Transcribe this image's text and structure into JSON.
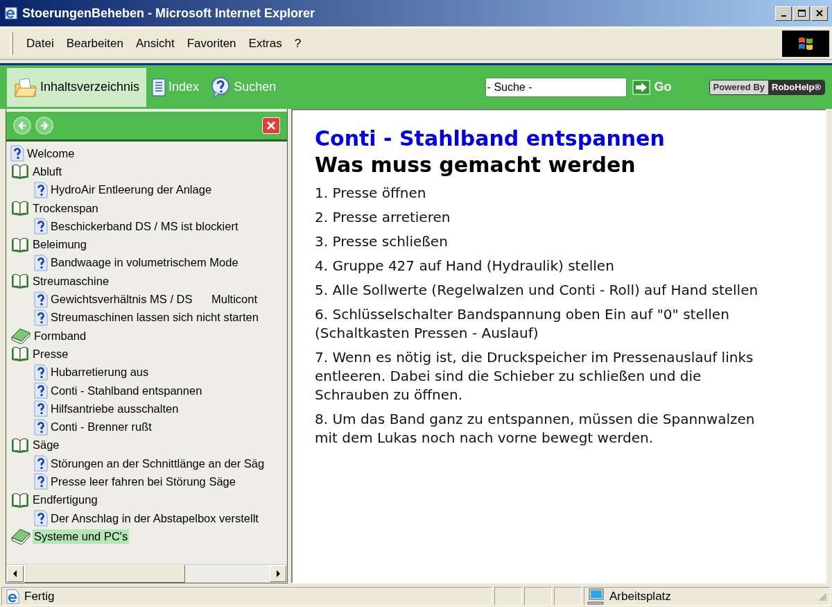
{
  "window": {
    "title": "StoerungenBeheben - Microsoft Internet Explorer"
  },
  "menu": [
    "Datei",
    "Bearbeiten",
    "Ansicht",
    "Favoriten",
    "Extras",
    "?"
  ],
  "help_toolbar": {
    "tabs": [
      {
        "label": "Inhaltsverzeichnis",
        "kind": "contents",
        "selected": true
      },
      {
        "label": "Index",
        "kind": "index",
        "selected": false
      },
      {
        "label": "Suchen",
        "kind": "search",
        "selected": false
      }
    ],
    "search": {
      "value": "- Suche -"
    },
    "go_label": "Go",
    "badge": {
      "prefix": "Powered By",
      "name": "RoboHelp®"
    }
  },
  "toc": [
    {
      "label": "Welcome",
      "kind": "topic",
      "selected": false
    },
    {
      "label": "Abluft",
      "kind": "book",
      "expanded": true,
      "selected": false,
      "children": [
        {
          "label": "HydroAir Entleerung der Anlage",
          "kind": "topic",
          "selected": false
        }
      ]
    },
    {
      "label": "Trockenspan",
      "kind": "book",
      "expanded": true,
      "selected": false,
      "children": [
        {
          "label": "Beschickerband DS / MS ist blockiert",
          "kind": "topic",
          "selected": false
        }
      ]
    },
    {
      "label": "Beleimung",
      "kind": "book",
      "expanded": true,
      "selected": false,
      "children": [
        {
          "label": "Bandwaage in volumetrischem Mode",
          "kind": "topic",
          "selected": false
        }
      ]
    },
    {
      "label": "Streumaschine",
      "kind": "book",
      "expanded": true,
      "selected": false,
      "children": [
        {
          "label": "Gewichtsverhältnis MS / DS      Multicont",
          "kind": "topic",
          "selected": false
        },
        {
          "label": "Streumaschinen lassen sich nicht starten",
          "kind": "topic",
          "selected": false
        }
      ]
    },
    {
      "label": "Formband",
      "kind": "book",
      "expanded": false,
      "selected": false
    },
    {
      "label": "Presse",
      "kind": "book",
      "expanded": true,
      "selected": false,
      "children": [
        {
          "label": "Hubarretierung aus",
          "kind": "topic",
          "selected": false
        },
        {
          "label": "Conti - Stahlband entspannen",
          "kind": "topic",
          "selected": false
        },
        {
          "label": "Hilfsantriebe ausschalten",
          "kind": "topic",
          "selected": false
        },
        {
          "label": "Conti - Brenner rußt",
          "kind": "topic",
          "selected": false
        }
      ]
    },
    {
      "label": "Säge",
      "kind": "book",
      "expanded": true,
      "selected": false,
      "children": [
        {
          "label": "Störungen an der Schnittlänge an der Säg",
          "kind": "topic",
          "selected": false
        },
        {
          "label": "Presse leer fahren bei Störung Säge",
          "kind": "topic",
          "selected": false
        }
      ]
    },
    {
      "label": "Endfertigung",
      "kind": "book",
      "expanded": true,
      "selected": false,
      "children": [
        {
          "label": "Der Anschlag in der Abstapelbox verstellt",
          "kind": "topic",
          "selected": false
        }
      ]
    },
    {
      "label": "Systeme und PC's",
      "kind": "book",
      "expanded": false,
      "selected": true
    }
  ],
  "topic": {
    "title": "Conti - Stahlband entspannen",
    "subtitle": "Was muss gemacht werden",
    "steps": [
      "1. Presse öffnen",
      "2. Presse arretieren",
      "3. Presse schließen",
      "4. Gruppe 427 auf Hand (Hydraulik) stellen",
      "5. Alle Sollwerte (Regelwalzen und Conti - Roll) auf Hand stellen",
      "6. Schlüsselschalter Bandspannung oben Ein auf \"0\" stellen (Schaltkasten Pressen - Auslauf)",
      "7. Wenn es nötig ist, die Druckspeicher im Pressenauslauf links entleeren. Dabei sind die Schieber zu schließen und die Schrauben zu öffnen.",
      "8. Um das Band ganz zu entspannen, müssen die Spannwalzen mit dem Lukas noch nach vorne bewegt werden."
    ]
  },
  "status_bar": {
    "text": "Fertig",
    "zone": "Arbeitsplatz"
  }
}
